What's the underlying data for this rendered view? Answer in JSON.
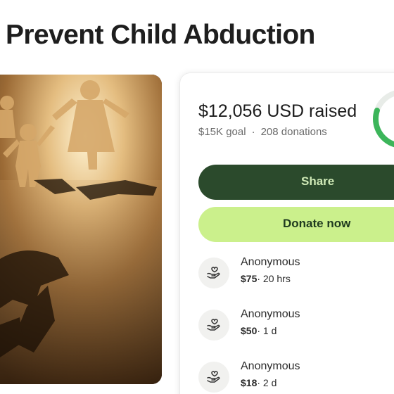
{
  "title": "Prevent Child Abduction",
  "campaign": {
    "raised": "$12,056 USD raised",
    "goal": "$15K goal",
    "separator": "·",
    "donations": "208 donations",
    "progress_fraction": 0.8
  },
  "buttons": {
    "share": "Share",
    "donate": "Donate now"
  },
  "donations_list": [
    {
      "name": "Anonymous",
      "amount": "$75",
      "time": "· 20 hrs"
    },
    {
      "name": "Anonymous",
      "amount": "$50",
      "time": "· 1 d"
    },
    {
      "name": "Anonymous",
      "amount": "$18",
      "time": "· 2 d"
    }
  ],
  "icons": {
    "donor": "hand-heart-icon"
  },
  "colors": {
    "share_bg": "#2b4a2c",
    "donate_bg": "#cbf08c",
    "progress": "#3cb55a"
  }
}
